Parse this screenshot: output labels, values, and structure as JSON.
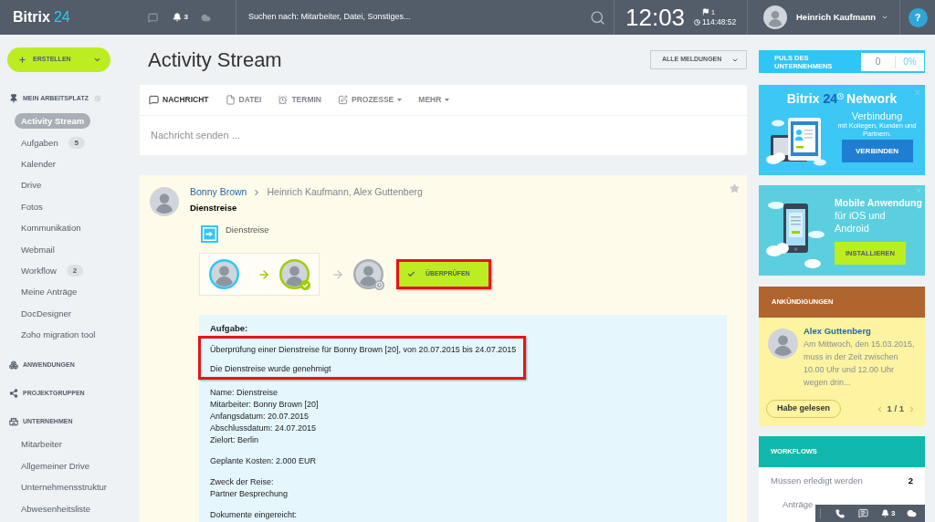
{
  "topbar": {
    "logo": {
      "name": "Bitrix",
      "number": "24"
    },
    "notifications": "3",
    "search": {
      "placeholder": "Suchen nach: Mitarbeiter, Datei, Sonstiges..."
    },
    "clock": {
      "time": "12:03",
      "flags": "1",
      "timer": "114:48:52"
    },
    "user": {
      "name": "Heinrich Kaufmann"
    },
    "help": "?"
  },
  "sidebar": {
    "create_button": "ERSTELLEN",
    "sections": [
      {
        "title": "MEIN ARBEITSPLATZ",
        "items": [
          {
            "label": "Activity Stream",
            "selected": true
          },
          {
            "label": "Aufgaben",
            "count": "5",
            "selected": false
          },
          {
            "label": "Kalender",
            "selected": false
          },
          {
            "label": "Drive",
            "selected": false
          },
          {
            "label": "Fotos",
            "selected": false
          },
          {
            "label": "Kommunikation",
            "selected": false
          },
          {
            "label": "Webmail",
            "selected": false
          },
          {
            "label": "Workflow",
            "count": "2",
            "selected": false
          },
          {
            "label": "Meine Anträge",
            "selected": false
          },
          {
            "label": "DocDesigner",
            "selected": false
          },
          {
            "label": "Zoho migration tool",
            "selected": false
          }
        ]
      },
      {
        "title": "ANWENDUNGEN"
      },
      {
        "title": "PROJEKTGRUPPEN"
      },
      {
        "title": "UNTERNEHMEN",
        "items": [
          {
            "label": "Mitarbeiter",
            "selected": false
          },
          {
            "label": "Allgemeiner Drive",
            "selected": false
          },
          {
            "label": "Unternehmensstruktur",
            "selected": false
          },
          {
            "label": "Abwesenheitsliste",
            "selected": false
          }
        ]
      }
    ]
  },
  "page": {
    "title": "Activity Stream",
    "filter": "ALLE MELDUNGEN"
  },
  "composer": {
    "tabs": [
      {
        "label": "NACHRICHT",
        "selected": true,
        "dropdown": false
      },
      {
        "label": "DATEI",
        "selected": false,
        "dropdown": false
      },
      {
        "label": "TERMIN",
        "selected": false,
        "dropdown": false
      },
      {
        "label": "PROZESSE",
        "selected": false,
        "dropdown": true
      },
      {
        "label": "MEHR",
        "selected": false,
        "dropdown": true
      }
    ],
    "placeholder": "Nachricht senden ..."
  },
  "post": {
    "author": "Bonny Brown",
    "recipients": "Heinrich Kaufmann, Alex Guttenberg",
    "title": "Dienstreise",
    "process": "Dienstreise",
    "workflow": [
      {
        "kind": "started"
      },
      {
        "kind": "approved"
      },
      {
        "kind": "waiting"
      }
    ],
    "action_button": {
      "label": "ÜBERPRÜFEN",
      "highlighted": true
    },
    "task": {
      "heading": "Aufgabe:",
      "summary": {
        "highlighted": true,
        "lines": [
          "Überprüfung einer Dienstreise für Bonny Brown [20], von 20.07.2015 bis 24.07.2015",
          "Die Dienstreise wurde genehmigt"
        ]
      },
      "details": [
        [
          "Name: Dienstreise",
          "Mitarbeiter: Bonny Brown [20]",
          "Anfangsdatum: 20.07.2015",
          "Abschlussdatum: 24.07.2015",
          "Zielort: Berlin"
        ],
        [
          "Geplante Kosten: 2.000 EUR"
        ],
        [
          "Zweck der Reise:",
          "Partner Besprechung"
        ],
        [
          "Dokumente eingereicht:"
        ]
      ]
    }
  },
  "widgets": {
    "pulse": {
      "title": "PULS DES UNTERNEHMENS",
      "count": "0",
      "percent": "0%"
    },
    "network": {
      "brand": "Bitrix",
      "number": "24",
      "product": "Network",
      "heading": "Verbindung",
      "text": "mit Kollegen, Kunden und Partnern.",
      "button": "VERBINDEN"
    },
    "mobile": {
      "heading": "Mobile Anwendung",
      "text": "für iOS und Android",
      "button": "INSTALLIEREN"
    },
    "announcements": {
      "title": "ANKÜNDIGUNGEN",
      "author": "Alex Guttenberg",
      "text": "Am Mittwoch, den 15.03.2015, muss in der Zeit zwischen 10.00 Uhr und 12.00 Uhr wegen drin...",
      "button": "Habe gelesen",
      "pager": "1 / 1"
    },
    "workflows": {
      "title": "WORKFLOWS",
      "rows": [
        {
          "label": "Müssen erledigt werden",
          "count": "2",
          "children": [
            {
              "label": "Anträge"
            }
          ]
        }
      ]
    }
  },
  "bottom_bar": {
    "notifications": "3"
  }
}
